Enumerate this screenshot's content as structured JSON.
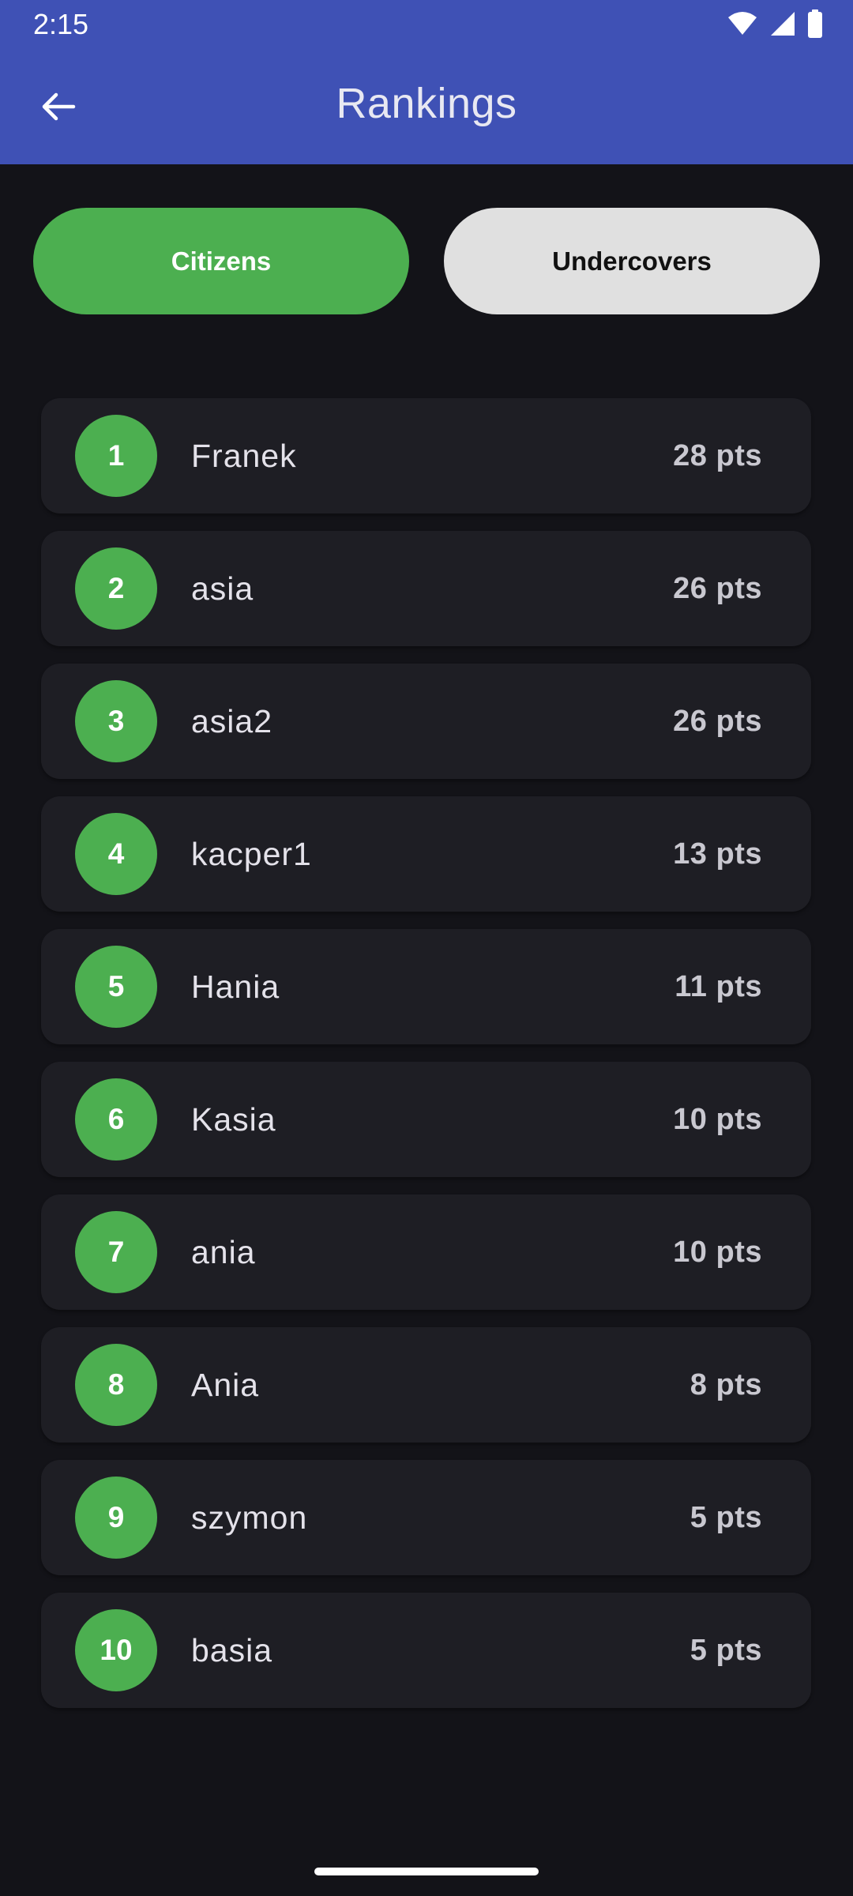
{
  "status_bar": {
    "time": "2:15",
    "icons": [
      "wifi-icon",
      "signal-icon",
      "battery-icon"
    ]
  },
  "toolbar": {
    "title": "Rankings",
    "back_icon": "arrow-back-icon"
  },
  "tabs": [
    {
      "label": "Citizens",
      "selected": true
    },
    {
      "label": "Undercovers",
      "selected": false
    }
  ],
  "rankings": [
    {
      "rank": "1",
      "name": "Franek",
      "points": "28 pts"
    },
    {
      "rank": "2",
      "name": "asia",
      "points": "26 pts"
    },
    {
      "rank": "3",
      "name": "asia2",
      "points": "26 pts"
    },
    {
      "rank": "4",
      "name": "kacper1",
      "points": "13 pts"
    },
    {
      "rank": "5",
      "name": "Hania",
      "points": "11 pts"
    },
    {
      "rank": "6",
      "name": "Kasia",
      "points": "10 pts"
    },
    {
      "rank": "7",
      "name": "ania",
      "points": "10 pts"
    },
    {
      "rank": "8",
      "name": "Ania",
      "points": "8 pts"
    },
    {
      "rank": "9",
      "name": "szymon",
      "points": "5 pts"
    },
    {
      "rank": "10",
      "name": "basia",
      "points": "5 pts"
    }
  ],
  "colors": {
    "app_bar": "#3f51b5",
    "background": "#131318",
    "accent_green": "#4caf50",
    "row_background": "#1e1e24",
    "tab_inactive": "#e0e0e0"
  }
}
